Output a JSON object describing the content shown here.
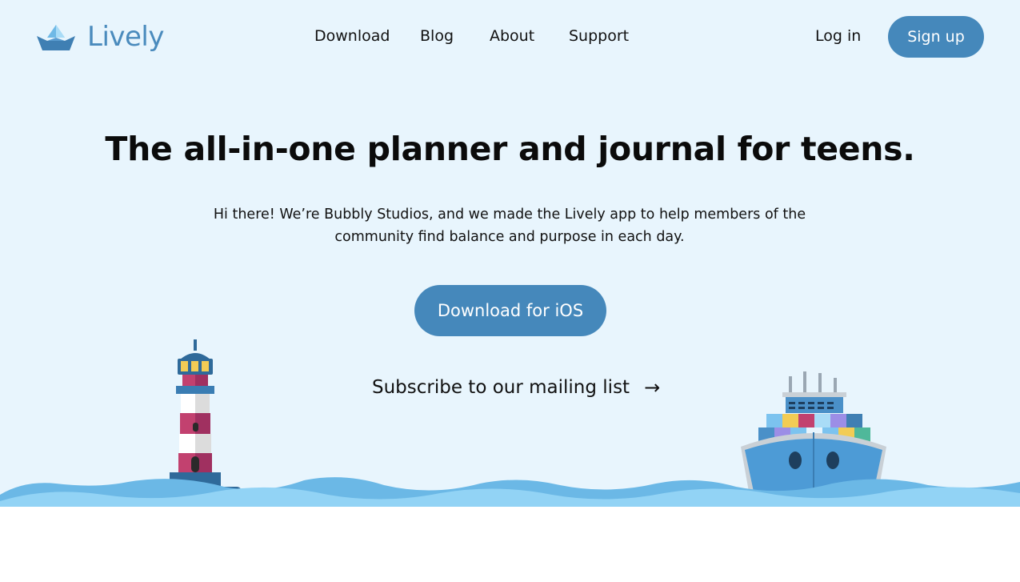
{
  "brand": {
    "name": "Lively"
  },
  "nav": {
    "items": [
      {
        "label": "Download"
      },
      {
        "label": "Blog"
      },
      {
        "label": "About"
      },
      {
        "label": "Support"
      }
    ],
    "login_label": "Log in",
    "signup_label": "Sign up"
  },
  "hero": {
    "headline": "The all-in-one planner and journal for teens.",
    "subtext": "Hi there! We’re Bubbly Studios, and we made the Lively app to help members of the community find balance and purpose in each day.",
    "cta_label": "Download for iOS",
    "subscribe_label": "Subscribe to our mailing list",
    "subscribe_arrow": "→"
  },
  "colors": {
    "accent": "#4588bb",
    "hero_bg": "#e8f5fd",
    "logo_text": "#4a8bbd"
  }
}
